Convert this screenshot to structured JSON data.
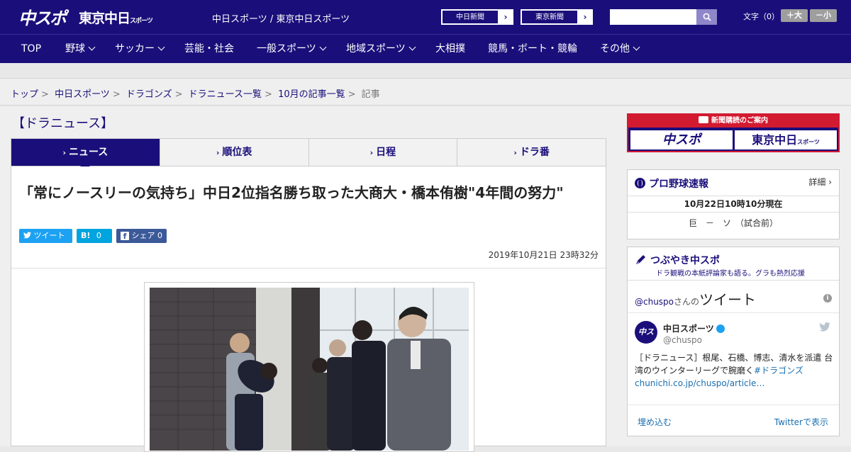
{
  "header": {
    "logo_main": "中スポ",
    "logo_tokyo": "東京中日",
    "logo_tokyo_small": "スポーツ",
    "site_name": "中日スポーツ / 東京中日スポーツ",
    "paper_links": [
      {
        "label": "中日新聞",
        "arrow": "›"
      },
      {
        "label": "東京新聞",
        "arrow": "›"
      }
    ],
    "search_placeholder": "",
    "font_size_label": "文字（0）",
    "font_plus": "＋大",
    "font_minus": "－小"
  },
  "nav": {
    "items": [
      {
        "label": "TOP",
        "dropdown": false
      },
      {
        "label": "野球",
        "dropdown": true
      },
      {
        "label": "サッカー",
        "dropdown": true
      },
      {
        "label": "芸能・社会",
        "dropdown": false
      },
      {
        "label": "一般スポーツ",
        "dropdown": true
      },
      {
        "label": "地域スポーツ",
        "dropdown": true
      },
      {
        "label": "大相撲",
        "dropdown": false
      },
      {
        "label": "競馬・ボート・競輪",
        "dropdown": false
      },
      {
        "label": "その他",
        "dropdown": true
      }
    ]
  },
  "breadcrumb": {
    "items": [
      "トップ",
      "中日スポーツ",
      "ドラゴンズ",
      "ドラニュース一覧",
      "10月の記事一覧"
    ],
    "current": "記事",
    "separator": ">"
  },
  "section_title": "【ドラニュース】",
  "tabs": [
    {
      "label": "ニュース",
      "active": true
    },
    {
      "label": "順位表",
      "active": false
    },
    {
      "label": "日程",
      "active": false
    },
    {
      "label": "ドラ番",
      "active": false
    }
  ],
  "article": {
    "headline": "「常にノースリーの気持ち」中日2位指名勝ち取った大商大・橋本侑樹\"4年間の努力\"",
    "share": {
      "tweet_label": "ツイート",
      "hatena_label": "B!",
      "hatena_count": "0",
      "facebook_label": "シェア",
      "facebook_count": "0"
    },
    "published": "2019年10月21日 23時32分"
  },
  "sidebar": {
    "subscription": {
      "heading": "新聞購読のご案内",
      "logo_main": "中スポ",
      "logo_tokyo": "東京中日",
      "logo_tokyo_small": "スポーツ"
    },
    "baseball": {
      "title": "プロ野球速報",
      "more": "詳細 ›",
      "as_of": "10月22日10時10分現在",
      "game": "巨　－　ソ　（試合前）"
    },
    "tsubuyaki": {
      "title": "つぶやき中スポ",
      "subtitle": "ドラ観戦の本紙評論家も語る。グラも熱烈応援",
      "handle_head": "@chuspo",
      "san": "さんの",
      "tweet_word": "ツイート",
      "info": "i",
      "avatar_text": "中スポ",
      "account_name": "中日スポーツ",
      "account_handle": "@chuspo",
      "tweet_text": "［ドラニュース］根尾、石橋、博志、清水を派遣 台湾のウインターリーグで腕磨く",
      "tweet_link": "#ドラゴンズchunichi.co.jp/chuspo/article…",
      "embed_label": "埋め込む",
      "view_label": "Twitterで表示"
    }
  },
  "colors": {
    "brand": "#1a0f7a",
    "ad_red": "#d21a30",
    "twitter": "#1da1f2",
    "hatena": "#00a4de",
    "facebook": "#3b5998"
  }
}
